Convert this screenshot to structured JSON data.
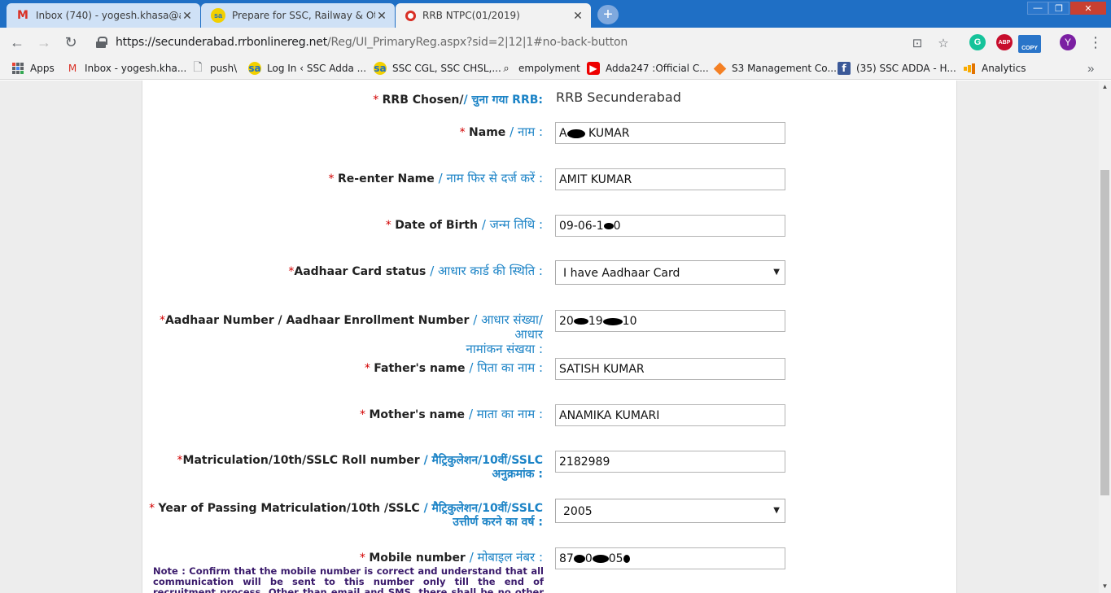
{
  "tabs": [
    {
      "title": "Inbox (740) - yogesh.khasa@add",
      "icon": "gmail-icon"
    },
    {
      "title": "Prepare for SSC, Railway & Other",
      "icon": "sscadda-icon"
    },
    {
      "title": "RRB NTPC(01/2019)",
      "icon": "rrb-icon"
    }
  ],
  "address": {
    "host": "https://secunderabad.rrbonlinereg.net",
    "path": "/Reg/UI_PrimaryReg.aspx?sid=2|12|1#no-back-button"
  },
  "profile_initial": "Y",
  "extensions": {
    "grammarly": "G",
    "abp": "ABP",
    "copy": "COPY"
  },
  "bookmarks": [
    {
      "label": "Apps"
    },
    {
      "label": "Inbox - yogesh.kha..."
    },
    {
      "label": "push\\"
    },
    {
      "label": "Log In ‹ SSC Adda ..."
    },
    {
      "label": "SSC CGL, SSC CHSL,..."
    },
    {
      "label": "empolyment"
    },
    {
      "label": "Adda247 :Official C..."
    },
    {
      "label": "S3 Management Co..."
    },
    {
      "label": "(35) SSC ADDA - H..."
    },
    {
      "label": "Analytics"
    }
  ],
  "form": {
    "rrb": {
      "label": "RRB Chosen/",
      "hindi": "/ चुना गया RRB:",
      "value": "RRB Secunderabad"
    },
    "name": {
      "label": "Name",
      "hindi": "/ नाम :",
      "value_start": "A",
      "value_end": " KUMAR"
    },
    "reenter_name": {
      "label": "Re-enter Name",
      "hindi": "/ नाम फिर से दर्ज करें :",
      "value": "AMIT KUMAR"
    },
    "dob": {
      "label": "Date of Birth",
      "hindi": "/ जन्म तिथि :",
      "value_start": "09-06-1",
      "value_end": "0"
    },
    "aadhaar_status": {
      "label": "Aadhaar Card status",
      "hindi": "/ आधार कार्ड की स्थिति :",
      "value": "I have Aadhaar Card"
    },
    "aadhaar_number": {
      "label": "Aadhaar Number / Aadhaar Enrollment Number",
      "hindi_line1": "/ आधार संख्या/ आधार",
      "hindi_line2": "नामांकन संखया :",
      "value_a": "20",
      "value_b": "19",
      "value_c": "10"
    },
    "father": {
      "label": "Father's name",
      "hindi": "/ पिता का नाम :",
      "value": "SATISH KUMAR"
    },
    "mother": {
      "label": "Mother's name",
      "hindi": "/ माता का नाम :",
      "value": "ANAMIKA KUMARI"
    },
    "roll": {
      "label": "Matriculation/10th/SSLC Roll number",
      "hindi_line1": "/ मैट्रिकुलेशन/10वीं/SSLC",
      "hindi_line2": "अनुक्रमांक :",
      "value": "2182989"
    },
    "year": {
      "label": "Year of Passing Matriculation/10th /SSLC",
      "hindi_line1": "/ मैट्रिकुलेशन/10वीं/SSLC",
      "hindi_line2": "उत्तीर्ण करने का वर्ष :",
      "value": "2005"
    },
    "mobile": {
      "label": "Mobile number",
      "hindi": "/ मोबाइल नंबर :",
      "value_a": "87",
      "value_b": "0",
      "value_c": "05"
    },
    "note": "Note : Confirm that the mobile number is correct and understand that all communication will be sent to this number only till the end of recruitment process. Other than email and SMS, there shall be no other mode of"
  }
}
